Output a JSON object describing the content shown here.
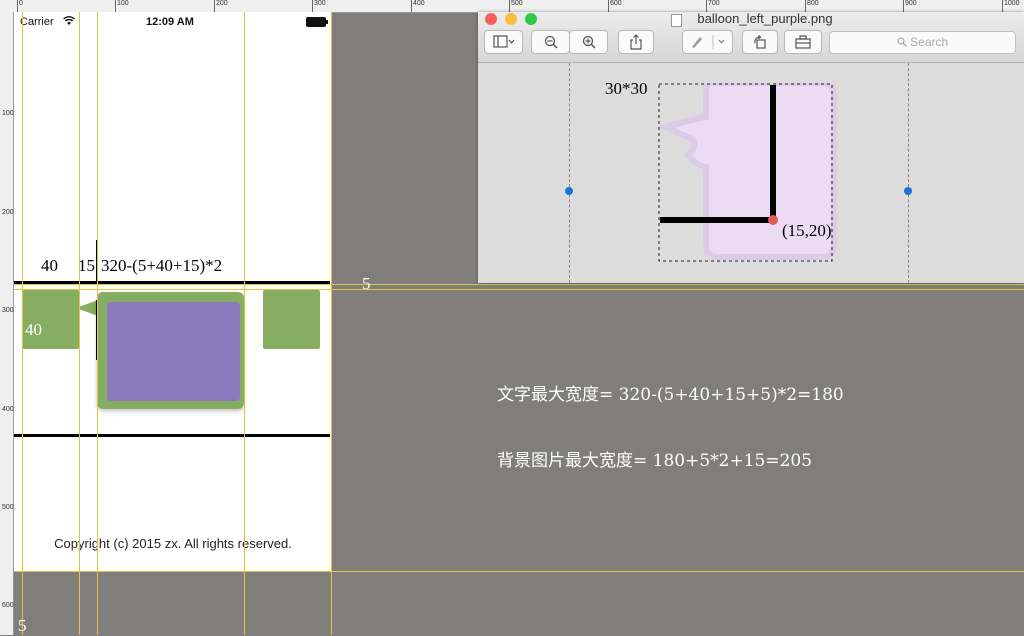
{
  "ruler": {
    "top_labels": [
      "0",
      "100",
      "200",
      "300",
      "400",
      "500",
      "600",
      "700",
      "800",
      "900",
      "1000"
    ],
    "left_labels": [
      "100",
      "200",
      "300",
      "400",
      "500",
      "600"
    ]
  },
  "phone": {
    "carrier": "Carrier",
    "time": "12:09 AM",
    "icons": {
      "wifi": "wifi-icon",
      "battery": "battery-icon"
    },
    "measure_40": "40",
    "measure_15": "15",
    "measure_formula": "320-(5+40+15)*2",
    "measure_5_right": "5",
    "avatar_label": "40",
    "copyright": "Copyright (c) 2015 zx. All rights reserved.",
    "bottom_5": "5"
  },
  "preview": {
    "title": "balloon_left_purple.png",
    "toolbar": {
      "sidebar_icon": "sidebar-icon",
      "zoom_out_icon": "zoom-out-icon",
      "zoom_in_icon": "zoom-in-icon",
      "share_icon": "share-icon",
      "markup_icon": "pen-icon",
      "rotate_icon": "rotate-icon",
      "toolbox_icon": "toolbox-icon",
      "search_placeholder": "Search"
    },
    "size_label": "30*30",
    "point_label": "(15,20)"
  },
  "notes": {
    "text_max_width": "文字最大宽度= 320-(5+40+15+5)*2=180",
    "bg_max_width": "背景图片最大宽度= 180+5*2+15=205"
  },
  "colors": {
    "background": "#7f7e7a",
    "guide": "#e3c440",
    "bubble_green": "#86ad62",
    "bubble_purple": "#8b78bd",
    "balloon_pink": "#ecdcf3",
    "traffic_red": "#fc605c",
    "traffic_yellow": "#fdbc40",
    "traffic_green": "#34c84a",
    "point_red": "#e05a5a",
    "dot_blue": "#1f73d6"
  }
}
